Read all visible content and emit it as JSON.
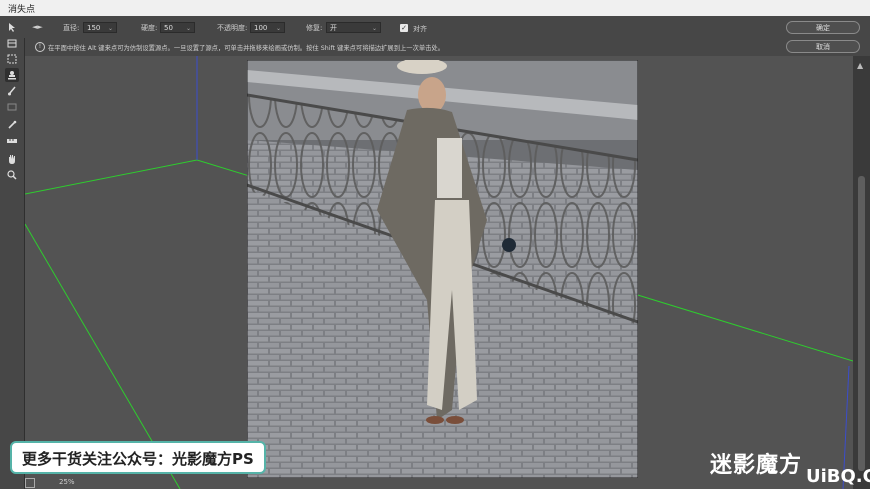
{
  "window": {
    "title": "消失点"
  },
  "options": {
    "nav_arrows": "◄►",
    "diameter_label": "直径:",
    "diameter_value": "150",
    "hardness_label": "硬度:",
    "hardness_value": "50",
    "opacity_label": "不透明度:",
    "opacity_value": "100",
    "heal_label": "修复:",
    "heal_value": "开",
    "align_label": "对齐",
    "align_checked": true
  },
  "info": {
    "text": "在平面中按住 Alt 键来点可为仿制设置源点。一旦设置了源点，可单击并拖移来绘画或仿制。按住 Shift 键来点可将描边扩展到上一次单击处。"
  },
  "buttons": {
    "ok": "确定",
    "cancel": "取消"
  },
  "tools": [
    {
      "name": "edit-plane-icon"
    },
    {
      "name": "create-plane-icon"
    },
    {
      "name": "marquee-icon"
    },
    {
      "name": "stamp-icon"
    },
    {
      "name": "brush-icon"
    },
    {
      "name": "transform-icon"
    },
    {
      "name": "eyedropper-icon"
    },
    {
      "name": "measure-icon"
    },
    {
      "name": "hand-icon"
    },
    {
      "name": "zoom-icon"
    }
  ],
  "status": {
    "zoom": "25%"
  },
  "watermark": {
    "text": "更多干货关注公众号：光影魔方PS"
  },
  "logo": {
    "text": "迷影魔方",
    "site": "UiBQ.CoM"
  },
  "colors": {
    "grid": "#2ecc2e",
    "accent": "#55b3a8"
  }
}
